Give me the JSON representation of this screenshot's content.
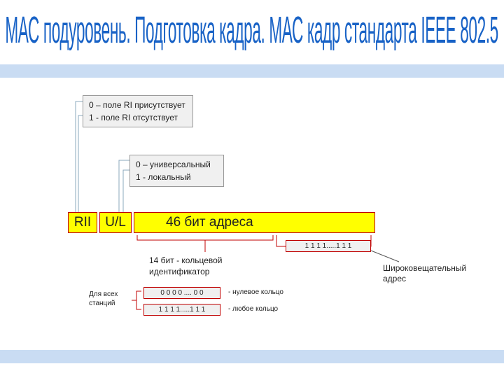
{
  "title": "МАС подуровень.  Подготовка кадра. МАС кадр стандарта IEEE 802.5",
  "note_ri": {
    "line0": "0 – поле RI присутствует",
    "line1": "1 - поле RI отсутствует"
  },
  "note_ul": {
    "line0": "0 – универсальный",
    "line1": "1 - локальный"
  },
  "fields": {
    "rii": "RII",
    "ul": "U/L",
    "addr46": "46 бит адреса"
  },
  "ring14": "14 бит - кольцевой идентификатор",
  "bcast": "Широковещательный адрес",
  "all_stations": "Для всех станций",
  "pattern_ones": "1 1 1 1.....1 1 1",
  "pattern_zeros": "0 0 0 0 .... 0 0",
  "zero_ring": "- нулевое кольцо",
  "any_ring": "- любое кольцо"
}
